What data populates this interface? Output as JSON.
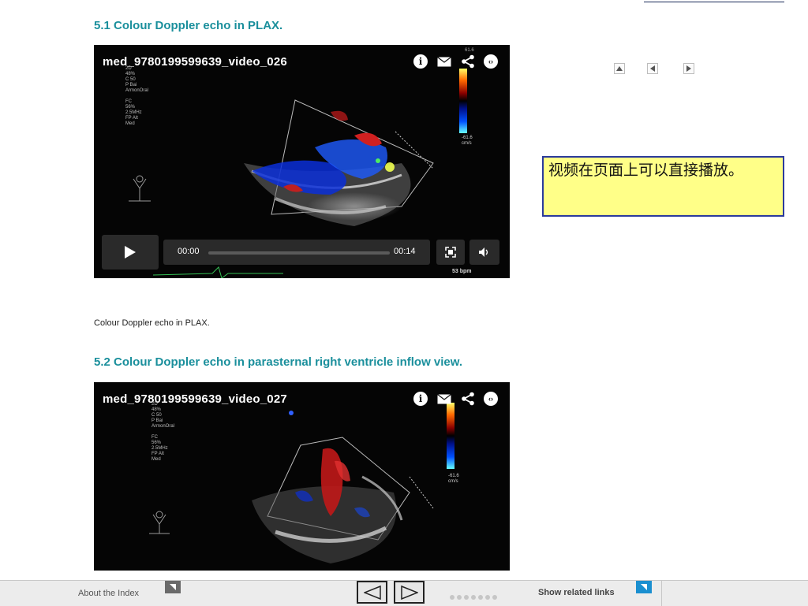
{
  "sections": [
    {
      "heading": "5.1 Colour Doppler echo in PLAX.",
      "video_title": "med_9780199599639_video_026",
      "time_current": "00:00",
      "time_total": "00:14",
      "bpm": "53 bpm",
      "scale_top": "61.6",
      "scale_bottom": "-61.6",
      "scale_unit": "cm/s",
      "caption": "Colour Doppler echo in PLAX."
    },
    {
      "heading": "5.2 Colour Doppler echo in parasternal right ventricle inflow view.",
      "video_title": "med_9780199599639_video_027",
      "scale_bottom": "-61.6",
      "scale_unit": "cm/s"
    }
  ],
  "overlay_params": "2D\n48%\nC 50\nP Bai\nArmonOral\n\nFC\n56%\n2.5MHz\nFP Alt\nMed",
  "note": "视频在页面上可以直接播放。",
  "footer": {
    "about_label": "About the Index",
    "related_label": "Show related links"
  },
  "colors": {
    "heading": "#1a8f9c",
    "note_bg": "#ffff88",
    "note_border": "#2b3a9c",
    "footer_icon": "#1a8fd0"
  }
}
